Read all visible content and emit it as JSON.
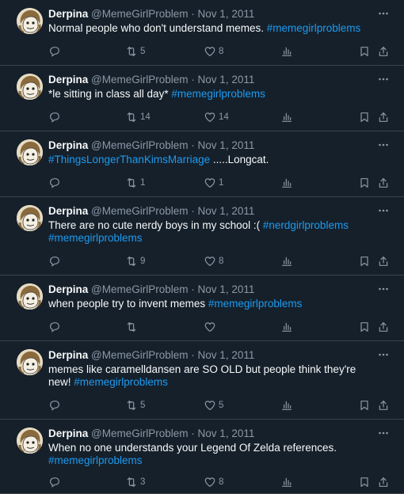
{
  "tweets": [
    {
      "name": "Derpina",
      "handle": "@MemeGirlProblem",
      "sep": "·",
      "date": "Nov 1, 2011",
      "text_parts": [
        {
          "t": "Normal people who don't understand memes. "
        },
        {
          "t": "#memegirlproblems",
          "tag": true
        }
      ],
      "retweets": "5",
      "likes": "8"
    },
    {
      "name": "Derpina",
      "handle": "@MemeGirlProblem",
      "sep": "·",
      "date": "Nov 1, 2011",
      "text_parts": [
        {
          "t": "*le sitting in class all day* "
        },
        {
          "t": "#memegirlproblems",
          "tag": true
        }
      ],
      "retweets": "14",
      "likes": "14"
    },
    {
      "name": "Derpina",
      "handle": "@MemeGirlProblem",
      "sep": "·",
      "date": "Nov 1, 2011",
      "text_parts": [
        {
          "t": "#ThingsLongerThanKimsMarriage",
          "tag": true
        },
        {
          "t": " .....Longcat."
        }
      ],
      "retweets": "1",
      "likes": "1"
    },
    {
      "name": "Derpina",
      "handle": "@MemeGirlProblem",
      "sep": "·",
      "date": "Nov 1, 2011",
      "text_parts": [
        {
          "t": "There are no cute nerdy boys in my school :( "
        },
        {
          "t": "#nerdgirlproblems",
          "tag": true
        },
        {
          "t": " "
        },
        {
          "t": "#memegirlproblems",
          "tag": true
        }
      ],
      "retweets": "9",
      "likes": "8"
    },
    {
      "name": "Derpina",
      "handle": "@MemeGirlProblem",
      "sep": "·",
      "date": "Nov 1, 2011",
      "text_parts": [
        {
          "t": "when people try to invent memes "
        },
        {
          "t": "#memegirlproblems",
          "tag": true
        }
      ],
      "retweets": "",
      "likes": ""
    },
    {
      "name": "Derpina",
      "handle": "@MemeGirlProblem",
      "sep": "·",
      "date": "Nov 1, 2011",
      "text_parts": [
        {
          "t": "memes like caramelldansen are SO OLD but people think they're new! "
        },
        {
          "t": "#memegirlproblems",
          "tag": true
        }
      ],
      "retweets": "5",
      "likes": "5"
    },
    {
      "name": "Derpina",
      "handle": "@MemeGirlProblem",
      "sep": "·",
      "date": "Nov 1, 2011",
      "text_parts": [
        {
          "t": "When no one understands your Legend Of Zelda references. "
        },
        {
          "t": "#memegirlproblems",
          "tag": true
        }
      ],
      "retweets": "3",
      "likes": "8"
    }
  ],
  "icons": {
    "more": "more-icon",
    "reply": "reply-icon",
    "retweet": "retweet-icon",
    "like": "like-icon",
    "views": "views-icon",
    "bookmark": "bookmark-icon",
    "share": "share-icon"
  },
  "colors": {
    "background": "#15202b",
    "text": "#f7f9f9",
    "muted": "#8b98a5",
    "link": "#1d9bf0",
    "border": "#38444d"
  }
}
